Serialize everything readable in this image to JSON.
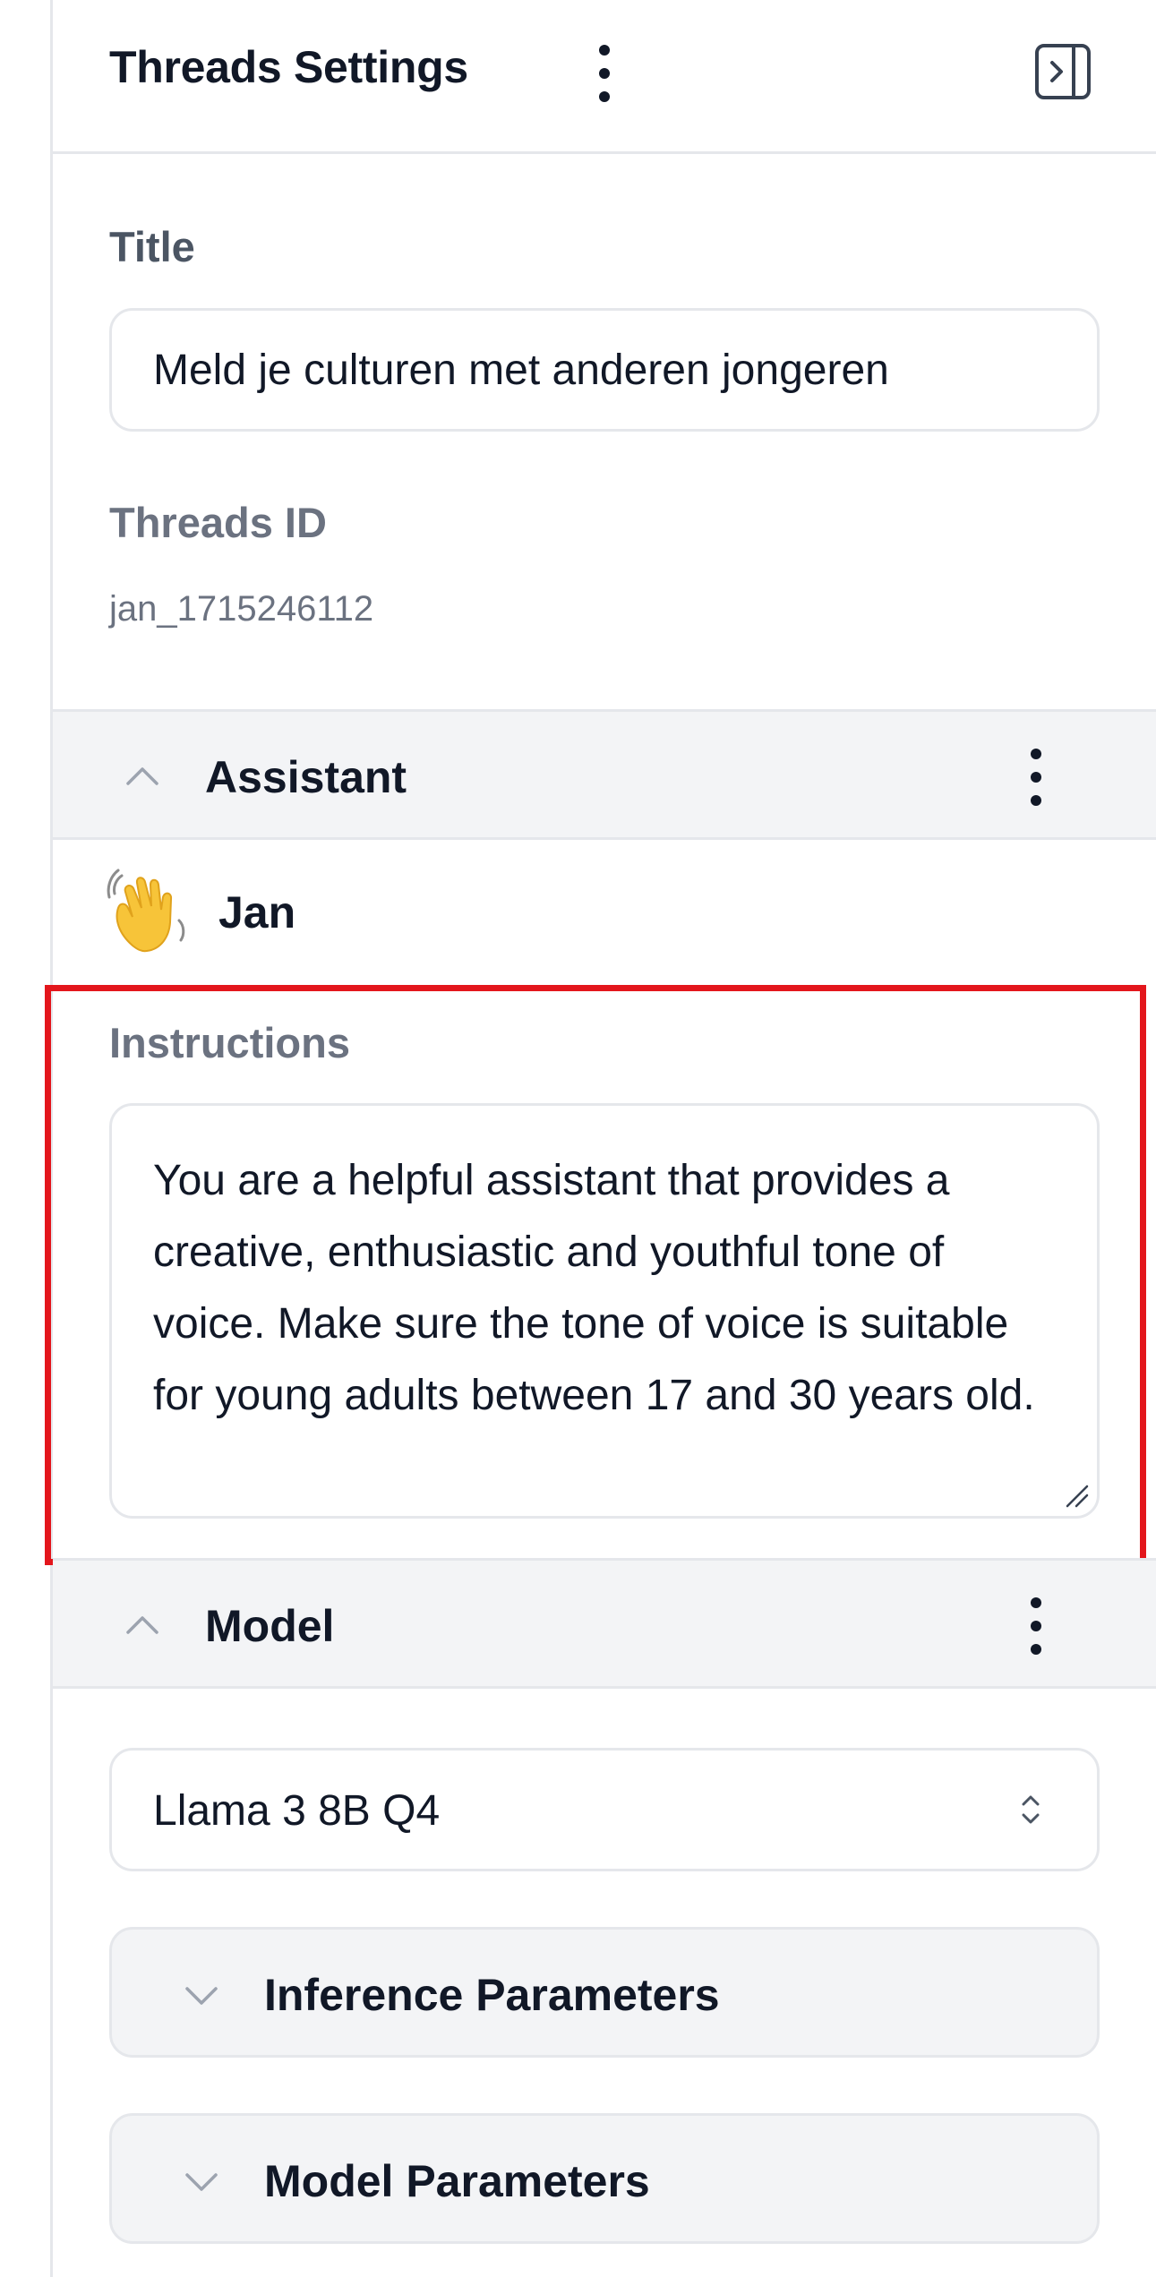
{
  "header": {
    "title": "Threads Settings"
  },
  "thread": {
    "title_label": "Title",
    "title_value": "Meld je culturen met anderen jongeren",
    "id_label": "Threads ID",
    "id_value": "jan_1715246112"
  },
  "assistant_section": {
    "label": "Assistant",
    "name": "Jan",
    "avatar_icon": "waving-hand-icon",
    "instructions_label": "Instructions",
    "instructions_value": "You are a helpful assistant that provides a creative, enthusiastic and youthful tone of voice. Make sure the tone of voice is suitable for young adults between 17 and 30 years old."
  },
  "model_section": {
    "label": "Model",
    "selected_model": "Llama 3 8B Q4",
    "inference_parameters_label": "Inference Parameters",
    "model_parameters_label": "Model Parameters"
  },
  "colors": {
    "highlight": "#e3161c",
    "section_background": "#f3f4f6",
    "border": "#e5e7eb",
    "muted_text": "#6b7280"
  }
}
